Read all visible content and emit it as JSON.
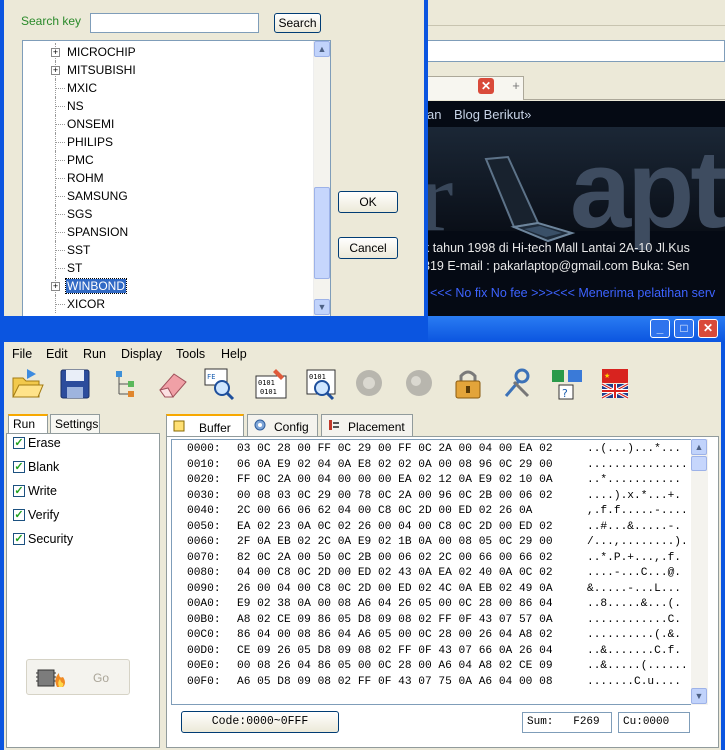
{
  "browser": {
    "menu_partial": "an",
    "menu_blog": "Blog Berikut»",
    "logo_left": "r",
    "logo_right": "apt",
    "info_line1": "k tahun 1998 di Hi-tech Mall Lantai 2A-10 Jl.Kus",
    "info_line2": "319 E-mail : pakarlaptop@gmail.com Buka: Sen",
    "marquee": "<<< No fix No fee >>><<< Menerima pelatihan serv",
    "tab_close_glyph": "✕",
    "tab_new_glyph": "+"
  },
  "search_dialog": {
    "label": "Search key",
    "input_value": "",
    "search_button": "Search",
    "ok_button": "OK",
    "cancel_button": "Cancel",
    "tree": [
      {
        "label": "MICROCHIP",
        "expandable": true,
        "selected": false
      },
      {
        "label": "MITSUBISHI",
        "expandable": true,
        "selected": false
      },
      {
        "label": "MXIC",
        "expandable": false,
        "selected": false
      },
      {
        "label": "NS",
        "expandable": false,
        "selected": false
      },
      {
        "label": "ONSEMI",
        "expandable": false,
        "selected": false
      },
      {
        "label": "PHILIPS",
        "expandable": false,
        "selected": false
      },
      {
        "label": "PMC",
        "expandable": false,
        "selected": false
      },
      {
        "label": "ROHM",
        "expandable": false,
        "selected": false
      },
      {
        "label": "SAMSUNG",
        "expandable": false,
        "selected": false
      },
      {
        "label": "SGS",
        "expandable": false,
        "selected": false
      },
      {
        "label": "SPANSION",
        "expandable": false,
        "selected": false
      },
      {
        "label": "SST",
        "expandable": false,
        "selected": false
      },
      {
        "label": "ST",
        "expandable": false,
        "selected": false
      },
      {
        "label": "WINBOND",
        "expandable": true,
        "selected": true
      },
      {
        "label": "XICOR",
        "expandable": false,
        "selected": false
      }
    ]
  },
  "main_window": {
    "title_buttons": {
      "minimize": "_",
      "maximize": "□",
      "close": "✕"
    },
    "menu": [
      "File",
      "Edit",
      "Run",
      "Display",
      "Tools",
      "Help"
    ],
    "toolbar_icons": [
      "open-icon",
      "save-icon",
      "tree-icon",
      "erase-icon",
      "search-chip-icon",
      "edit-hex-icon",
      "view-hex-icon",
      "disabled-gear-icon",
      "disabled-gear2-icon",
      "lock-icon",
      "tools-icon",
      "device-help-icon",
      "language-flag-icon"
    ],
    "left_tabs": [
      "Run",
      "Settings"
    ],
    "options": [
      {
        "label": "Erase",
        "checked": true
      },
      {
        "label": "Blank",
        "checked": true
      },
      {
        "label": "Write",
        "checked": true
      },
      {
        "label": "Verify",
        "checked": true
      },
      {
        "label": "Security",
        "checked": true
      }
    ],
    "check_glyph": "✓",
    "go_label": "Go",
    "right_tabs": [
      "Buffer",
      "Config",
      "Placement"
    ],
    "hex_rows": [
      {
        "addr": "0000:",
        "bytes": "03 0C 28 00 FF 0C 29 00 FF 0C 2A 00 04 00 EA 02",
        "ascii": "..(...)...*..."
      },
      {
        "addr": "0010:",
        "bytes": "06 0A E9 02 04 0A E8 02 02 0A 00 08 96 0C 29 00",
        "ascii": "..............."
      },
      {
        "addr": "0020:",
        "bytes": "FF 0C 2A 00 04 00 00 00 EA 02 12 0A E9 02 10 0A",
        "ascii": "..*..........."
      },
      {
        "addr": "0030:",
        "bytes": "00 08 03 0C 29 00 78 0C 2A 00 96 0C 2B 00 06 02",
        "ascii": "....).x.*...+."
      },
      {
        "addr": "0040:",
        "bytes": "2C 00 66 06 62 04 00 C8 0C 2D 00 ED 02 26 0A",
        "ascii": ",.f.f.....-...."
      },
      {
        "addr": "0050:",
        "bytes": "EA 02 23 0A 0C 02 26 00 04 00 C8 0C 2D 00 ED 02",
        "ascii": "..#...&.....-."
      },
      {
        "addr": "0060:",
        "bytes": "2F 0A EB 02 2C 0A E9 02 1B 0A 00 08 05 0C 29 00",
        "ascii": "/...,........)."
      },
      {
        "addr": "0070:",
        "bytes": "82 0C 2A 00 50 0C 2B 00 06 02 2C 00 66 00 66 02",
        "ascii": "..*.P.+...,.f."
      },
      {
        "addr": "0080:",
        "bytes": "04 00 C8 0C 2D 00 ED 02 43 0A EA 02 40 0A 0C 02",
        "ascii": "....-...C...@."
      },
      {
        "addr": "0090:",
        "bytes": "26 00 04 00 C8 0C 2D 00 ED 02 4C 0A EB 02 49 0A",
        "ascii": "&.....-...L..."
      },
      {
        "addr": "00A0:",
        "bytes": "E9 02 38 0A 00 08 A6 04 26 05 00 0C 28 00 86 04",
        "ascii": "..8.....&...(."
      },
      {
        "addr": "00B0:",
        "bytes": "A8 02 CE 09 86 05 D8 09 08 02 FF 0F 43 07 57 0A",
        "ascii": "............C."
      },
      {
        "addr": "00C0:",
        "bytes": "86 04 00 08 86 04 A6 05 00 0C 28 00 26 04 A8 02",
        "ascii": "..........(.&."
      },
      {
        "addr": "00D0:",
        "bytes": "CE 09 26 05 D8 09 08 02 FF 0F 43 07 66 0A 26 04",
        "ascii": "..&.......C.f."
      },
      {
        "addr": "00E0:",
        "bytes": "00 08 26 04 86 05 00 0C 28 00 A6 04 A8 02 CE 09",
        "ascii": "..&.....(......"
      },
      {
        "addr": "00F0:",
        "bytes": "A6 05 D8 09 08 02 FF 0F 43 07 75 0A A6 04 00 08",
        "ascii": ".......C.u...."
      }
    ],
    "code_range": "Code:0000~0FFF",
    "sum_label": "Sum:",
    "sum_value": "F269",
    "cu_label": "Cu:",
    "cu_value": "0000"
  }
}
